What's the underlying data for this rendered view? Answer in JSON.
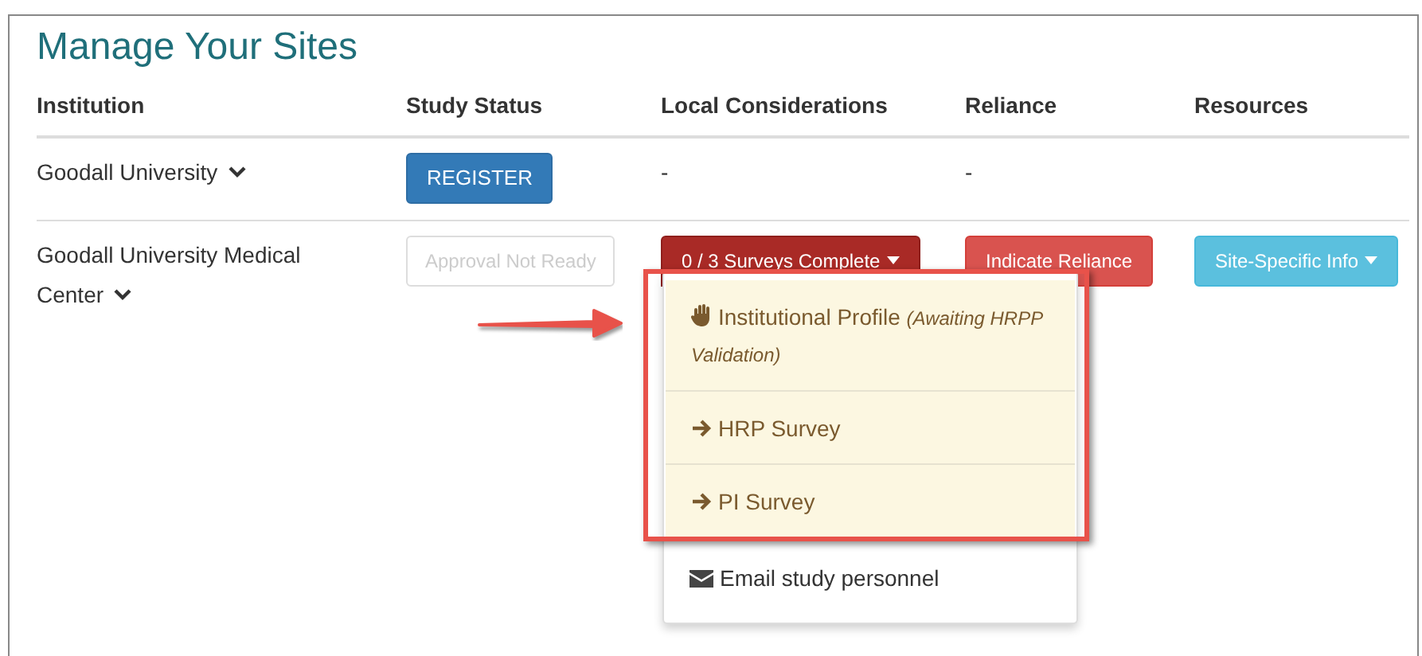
{
  "title": "Manage Your Sites",
  "columns": [
    "Institution",
    "Study Status",
    "Local Considerations",
    "Reliance",
    "Resources"
  ],
  "rows": [
    {
      "institution": "Goodall University",
      "study_status": {
        "kind": "primary",
        "label": "REGISTER"
      },
      "local": {
        "kind": "dash",
        "text": "-"
      },
      "reliance": {
        "kind": "dash",
        "text": "-"
      }
    },
    {
      "institution": "Goodall University Medical Center",
      "study_status": {
        "kind": "disabled",
        "label": "Approval Not Ready"
      },
      "local": {
        "kind": "dropdown",
        "label": "0 / 3 Surveys Complete",
        "expanded": true
      },
      "reliance": {
        "kind": "danger",
        "label": "Indicate Reliance"
      },
      "resources": {
        "kind": "dropdown",
        "label": "Site-Specific Info",
        "expanded": false
      }
    }
  ],
  "menu": {
    "annotation_arrow": true,
    "items": [
      {
        "kind": "hand",
        "label": "Institutional Profile",
        "note": "(Awaiting HRPP Validation)",
        "highlighted": true
      },
      {
        "kind": "arrow",
        "label": "HRP Survey",
        "highlighted": true
      },
      {
        "kind": "arrow",
        "label": "PI Survey",
        "highlighted": true
      },
      {
        "kind": "mail",
        "label": "Email study personnel",
        "highlighted": false
      }
    ]
  }
}
